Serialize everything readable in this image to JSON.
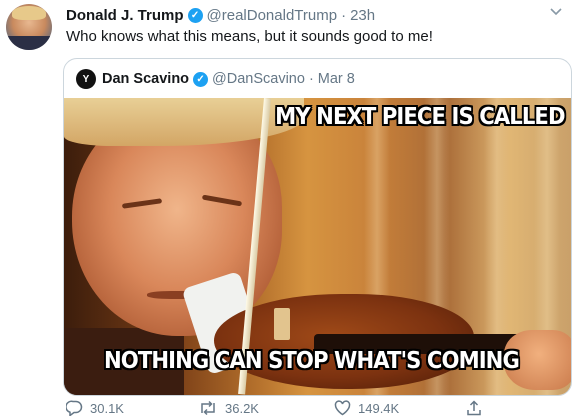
{
  "tweet": {
    "author_name": "Donald J. Trump",
    "author_handle": "@realDonaldTrump",
    "separator": "·",
    "time": "23h",
    "text": "Who knows what this means, but it sounds good to me!",
    "replies": "30.1K",
    "retweets": "36.2K",
    "likes": "149.4K"
  },
  "quoted": {
    "author_name": "Dan Scavino",
    "author_handle": "@DanScavino",
    "separator": "·",
    "date": "Mar 8",
    "avatar_letter": "Y",
    "meme_top_text": "MY NEXT PIECE IS CALLED",
    "meme_bottom_text": "NOTHING CAN STOP WHAT'S COMING"
  },
  "icons": {
    "verified": "verified-badge-icon",
    "caret": "chevron-down-icon",
    "reply": "reply-icon",
    "retweet": "retweet-icon",
    "like": "heart-icon",
    "share": "share-icon"
  },
  "colors": {
    "verified": "#1da1f2",
    "secondary_text": "#657786",
    "border": "#ccd6dd"
  }
}
